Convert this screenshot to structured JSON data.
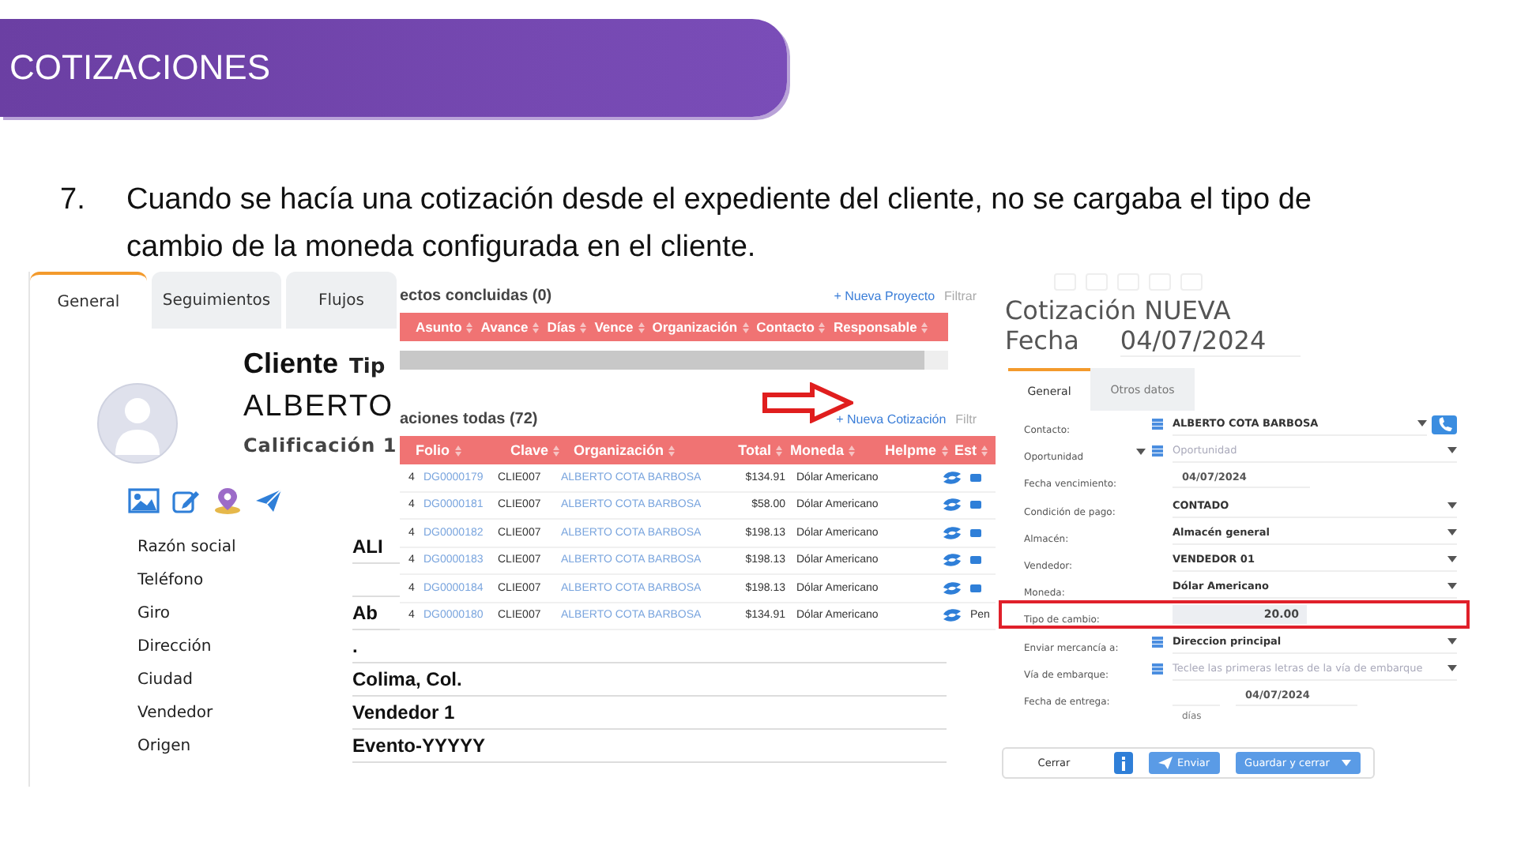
{
  "header": {
    "title": "COTIZACIONES"
  },
  "note": {
    "number": "7.",
    "text": "Cuando se hacía una cotización desde el expediente del cliente, no se cargaba el tipo de cambio de la moneda configurada en el cliente."
  },
  "client_panel": {
    "tabs": [
      {
        "label": "General",
        "selected": true
      },
      {
        "label": "Seguimientos",
        "selected": false
      },
      {
        "label": "Flujos",
        "selected": false
      }
    ],
    "heading": "Cliente",
    "type_label": "Tip",
    "name": "ALBERTO",
    "rating": "Calificación 1",
    "fields": [
      {
        "label": "Razón social",
        "value": "ALI"
      },
      {
        "label": "Teléfono"
      },
      {
        "label": "Giro",
        "value": "Ab"
      },
      {
        "label": "Dirección",
        "value": "."
      },
      {
        "label": "Ciudad",
        "value": "Colima, Col."
      },
      {
        "label": "Vendedor",
        "value": "Vendedor 1"
      },
      {
        "label": "Origen",
        "value": "Evento-YYYYY"
      }
    ]
  },
  "records_panel": {
    "projects": {
      "title": "ectos concluidas (0)",
      "action": "+ Nueva Proyecto",
      "filter": "Filtrar",
      "columns": [
        "Asunto",
        "Avance",
        "Días",
        "Vence",
        "Organización",
        "Contacto",
        "Responsable"
      ]
    },
    "quotes": {
      "title": "aciones todas (72)",
      "action": "+ Nueva Cotización",
      "filter": "Filtr",
      "columns": [
        "Folio",
        "Clave",
        "Organización",
        "Total",
        "Moneda",
        "Helpme",
        "Est"
      ],
      "rows": [
        {
          "index": "4",
          "folio": "DG0000179",
          "clave": "CLIE007",
          "organization": "ALBERTO COTA BARBOSA",
          "total": "$134.91",
          "currency": "Dólar Americano"
        },
        {
          "index": "4",
          "folio": "DG0000181",
          "clave": "CLIE007",
          "organization": "ALBERTO COTA BARBOSA",
          "total": "$58.00",
          "currency": "Dólar Americano"
        },
        {
          "index": "4",
          "folio": "DG0000182",
          "clave": "CLIE007",
          "organization": "ALBERTO COTA BARBOSA",
          "total": "$198.13",
          "currency": "Dólar Americano"
        },
        {
          "index": "4",
          "folio": "DG0000183",
          "clave": "CLIE007",
          "organization": "ALBERTO COTA BARBOSA",
          "total": "$198.13",
          "currency": "Dólar Americano"
        },
        {
          "index": "4",
          "folio": "DG0000184",
          "clave": "CLIE007",
          "organization": "ALBERTO COTA BARBOSA",
          "total": "$198.13",
          "currency": "Dólar Americano"
        },
        {
          "index": "4",
          "folio": "DG0000180",
          "clave": "CLIE007",
          "organization": "ALBERTO COTA BARBOSA",
          "total": "$134.91",
          "currency": "Dólar Americano",
          "status": "Pen"
        }
      ]
    }
  },
  "quote_form": {
    "title": "Cotización NUEVA",
    "date_label": "Fecha",
    "date": "04/07/2024",
    "tabs": [
      {
        "label": "General",
        "selected": true
      },
      {
        "label": "Otros datos",
        "selected": false
      }
    ],
    "rows": [
      {
        "kind": "select",
        "label": "Contacto:",
        "value": "ALBERTO COTA BARBOSA",
        "list_icon": true,
        "label_caret": false,
        "phone": true,
        "highlighted": false
      },
      {
        "kind": "select",
        "label": "Oportunidad",
        "placeholder": "Oportunidad",
        "list_icon": true,
        "label_caret": true,
        "phone": false,
        "highlighted": false
      },
      {
        "kind": "date",
        "label": "Fecha vencimiento:",
        "value": "04/07/2024",
        "list_icon": false,
        "label_caret": false,
        "phone": false,
        "highlighted": false
      },
      {
        "kind": "select",
        "label": "Condición de pago:",
        "value": "CONTADO",
        "list_icon": false,
        "label_caret": false,
        "phone": false,
        "highlighted": false
      },
      {
        "kind": "select",
        "label": "Almacén:",
        "value": "Almacén general",
        "list_icon": false,
        "label_caret": false,
        "phone": false,
        "highlighted": false
      },
      {
        "kind": "select",
        "label": "Vendedor:",
        "value": "VENDEDOR 01",
        "list_icon": false,
        "label_caret": false,
        "phone": false,
        "highlighted": false
      },
      {
        "kind": "select",
        "label": "Moneda:",
        "value": "Dólar Americano",
        "list_icon": false,
        "label_caret": false,
        "phone": false,
        "highlighted": false
      },
      {
        "kind": "number",
        "label": "Tipo de cambio:",
        "value": "20.00",
        "list_icon": false,
        "label_caret": false,
        "phone": false,
        "highlighted": true
      },
      {
        "kind": "select",
        "label": "Enviar mercancía a:",
        "value": "Direccion principal",
        "list_icon": true,
        "label_caret": false,
        "phone": false,
        "highlighted": false
      },
      {
        "kind": "select",
        "label": "Vía de embarque:",
        "placeholder": "Teclee las primeras letras de la vía de embarque",
        "list_icon": true,
        "label_caret": false,
        "phone": false,
        "highlighted": false
      },
      {
        "kind": "delivery",
        "label": "Fecha de entrega:",
        "value": "04/07/2024",
        "unit": "días",
        "list_icon": false,
        "label_caret": false,
        "phone": false,
        "highlighted": false
      }
    ],
    "buttons": [
      {
        "kind": "plain",
        "label": "Cerrar"
      },
      {
        "kind": "info"
      },
      {
        "kind": "send",
        "label": "Enviar"
      },
      {
        "kind": "split",
        "label": "Guardar y cerrar"
      }
    ]
  }
}
